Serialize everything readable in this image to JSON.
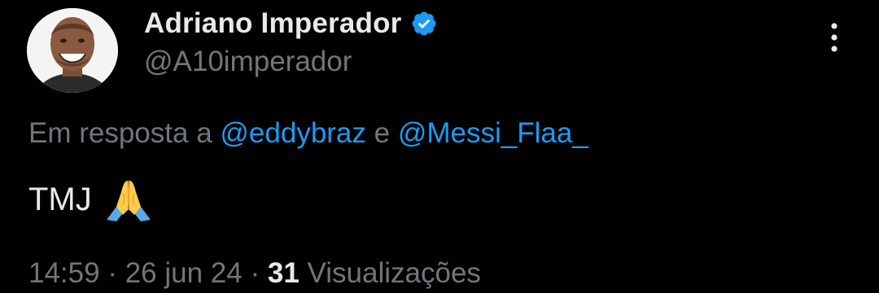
{
  "author": {
    "display_name": "Adriano Imperador",
    "handle": "@A10imperador",
    "verified_icon": "verified-badge-icon",
    "avatar": "avatar"
  },
  "reply": {
    "prefix": "Em resposta a",
    "mention_1": "@eddybraz",
    "conjunction": "e",
    "mention_2": "@Messi_Flaa_"
  },
  "tweet": {
    "text": "TMJ",
    "emoji": "folded-hands-emoji"
  },
  "meta": {
    "time": "14:59",
    "sep1": "·",
    "date": "26 jun 24",
    "sep2": "·",
    "views_count": "31",
    "views_label": "Visualizações"
  },
  "more_icon": "more-vertical-icon",
  "colors": {
    "background": "#000000",
    "primary_text": "#e7e9ea",
    "secondary_text": "#71767b",
    "link": "#1d9bf0",
    "verified": "#1d9bf0"
  }
}
